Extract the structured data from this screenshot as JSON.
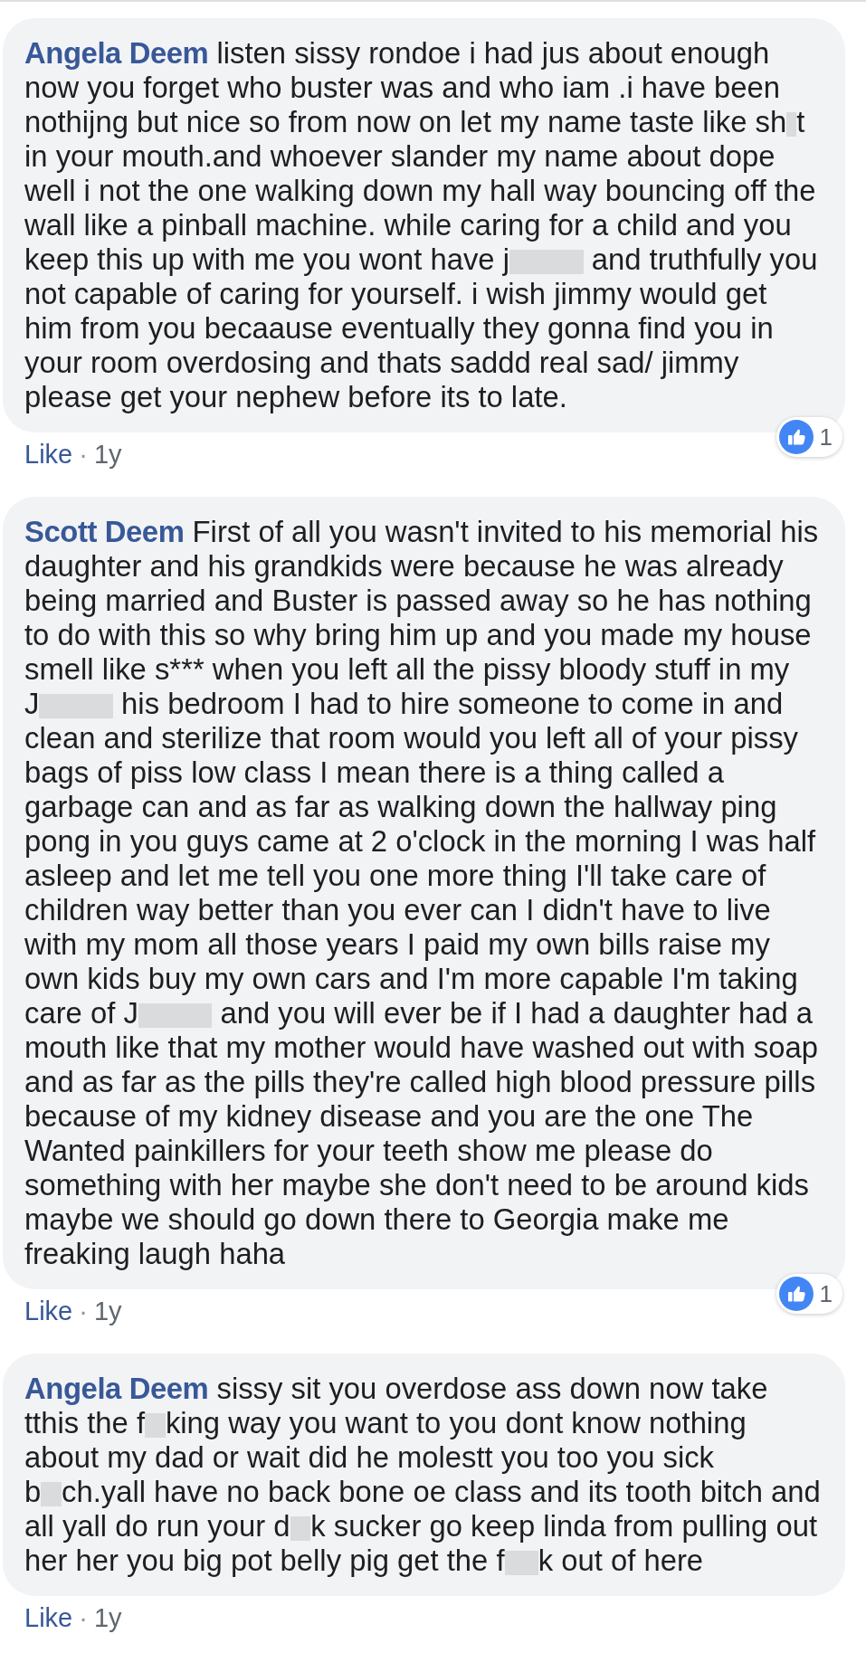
{
  "comments": [
    {
      "author": "Angela Deem",
      "body": [
        {
          "kind": "text",
          "text": "listen sissy rondoe i had jus about enough now you forget who buster was and who iam .i have been nothijng but nice so from now on let my name taste like sh"
        },
        {
          "kind": "redaction_narrow"
        },
        {
          "kind": "text",
          "text": "t in your mouth.and whoever slander my name about dope well i not the one walking down my hall way bouncing off the wall like a pinball machine. while caring for a child and you keep this up with me you wont have j"
        },
        {
          "kind": "redaction_wide"
        },
        {
          "kind": "text",
          "text": " and truthfully you not capable of caring for yourself. i wish jimmy would get him from you becaause eventually they gonna find you in your room overdosing and thats saddd real sad/ jimmy please get your nephew before its to late."
        }
      ],
      "like": "Like",
      "separator": "·",
      "time": "1y",
      "reactions": {
        "count": "1"
      }
    },
    {
      "author": "Scott Deem",
      "body": [
        {
          "kind": "text",
          "text": "First of all you wasn't invited to his memorial his daughter and his grandkids were because he was already being married and Buster is passed away so he has nothing to do with this so why bring him up and you made my house smell like s*** when you left all the pissy bloody stuff in my J"
        },
        {
          "kind": "redaction_wide"
        },
        {
          "kind": "text",
          "text": " his bedroom I had to hire someone to come in and clean and sterilize that room would you left all of your pissy bags of piss low class I mean there is a thing called a garbage can and as far as walking down the hallway ping pong in you guys came at 2 o'clock in the morning I was half asleep and let me tell you one more thing I'll take care of children way better than you ever can I didn't have to live with my mom all those years I paid my own bills raise my own kids buy my own cars and I'm more capable I'm taking care of J"
        },
        {
          "kind": "redaction_wide"
        },
        {
          "kind": "text",
          "text": " and you will ever be if I had a daughter had a mouth like that my mother would have washed out with soap and as far as the pills they're called high blood pressure pills because of my kidney disease and you are the one The Wanted painkillers for your teeth show me please do something with her maybe she don't need to be around kids maybe we should go down there to Georgia make me freaking laugh haha"
        }
      ],
      "like": "Like",
      "separator": "·",
      "time": "1y",
      "reactions": {
        "count": "1"
      }
    },
    {
      "author": "Angela Deem",
      "body": [
        {
          "kind": "text",
          "text": "sissy sit you overdose ass down now take tthis the f"
        },
        {
          "kind": "redaction_small"
        },
        {
          "kind": "text",
          "text": "king way you want to you dont know nothing about my dad or wait did he molestt you too you sick b"
        },
        {
          "kind": "redaction_small"
        },
        {
          "kind": "text",
          "text": "ch.yall have no back bone oe class and its tooth bitch and all yall do run your d"
        },
        {
          "kind": "redaction_small"
        },
        {
          "kind": "text",
          "text": "k sucker go keep linda from pulling out her her you big pot belly pig get the f"
        },
        {
          "kind": "redaction_medium"
        },
        {
          "kind": "text",
          "text": "k out of here"
        }
      ],
      "like": "Like",
      "separator": "·",
      "time": "1y"
    }
  ]
}
